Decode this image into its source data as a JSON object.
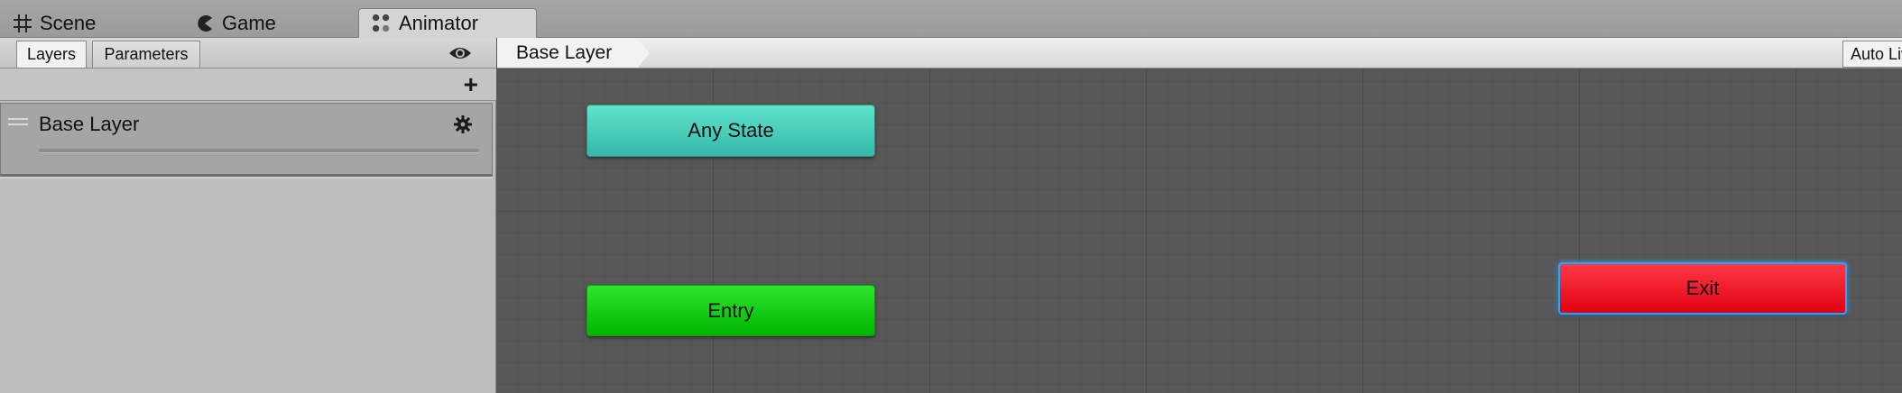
{
  "window_tabs": [
    {
      "label": "Scene",
      "icon": "grid-icon"
    },
    {
      "label": "Game",
      "icon": "pacman-icon"
    },
    {
      "label": "Animator",
      "icon": "animator-icon",
      "active": true
    }
  ],
  "left_panel": {
    "tabs": [
      {
        "label": "Layers",
        "active": true
      },
      {
        "label": "Parameters",
        "active": false
      }
    ],
    "layer": {
      "name": "Base Layer"
    }
  },
  "graph": {
    "breadcrumb": "Base Layer",
    "auto_live_label": "Auto Live Link",
    "nodes": {
      "any_state": "Any State",
      "entry": "Entry",
      "exit": "Exit"
    }
  },
  "colors": {
    "any_state": "#4fd1bd",
    "entry": "#10d010",
    "exit": "#f0101e",
    "selection": "#2aa2ff",
    "graph_background": "#575757"
  }
}
